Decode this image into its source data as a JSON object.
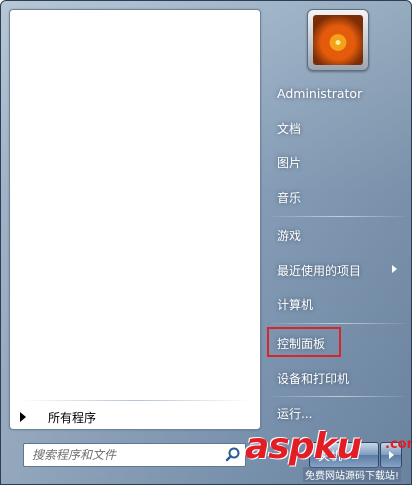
{
  "left_pane": {
    "all_programs": "所有程序",
    "search": {
      "placeholder": "搜索程序和文件",
      "value": ""
    }
  },
  "right_column": {
    "items": [
      {
        "id": "user",
        "label": "Administrator"
      },
      {
        "id": "documents",
        "label": "文档"
      },
      {
        "id": "pictures",
        "label": "图片"
      },
      {
        "id": "music",
        "label": "音乐"
      },
      {
        "id": "games",
        "label": "游戏"
      },
      {
        "id": "recent-items",
        "label": "最近使用的项目",
        "submenu": true
      },
      {
        "id": "computer",
        "label": "计算机"
      },
      {
        "id": "control-panel",
        "label": "控制面板",
        "highlighted": true
      },
      {
        "id": "devices-printers",
        "label": "设备和打印机"
      },
      {
        "id": "run",
        "label": "运行..."
      }
    ]
  },
  "shutdown": {
    "label": "关机"
  },
  "watermark": {
    "brand": "aspku",
    "suffix": ".com",
    "tagline": "免费网站源码下载站!"
  },
  "colors": {
    "highlight_border": "#d9242b",
    "watermark_red": "#e21d24",
    "menu_blue": "#7f98b3"
  },
  "icons": {
    "search": "search-icon",
    "all_programs": "play-arrow-icon",
    "submenu": "chevron-right-icon"
  }
}
